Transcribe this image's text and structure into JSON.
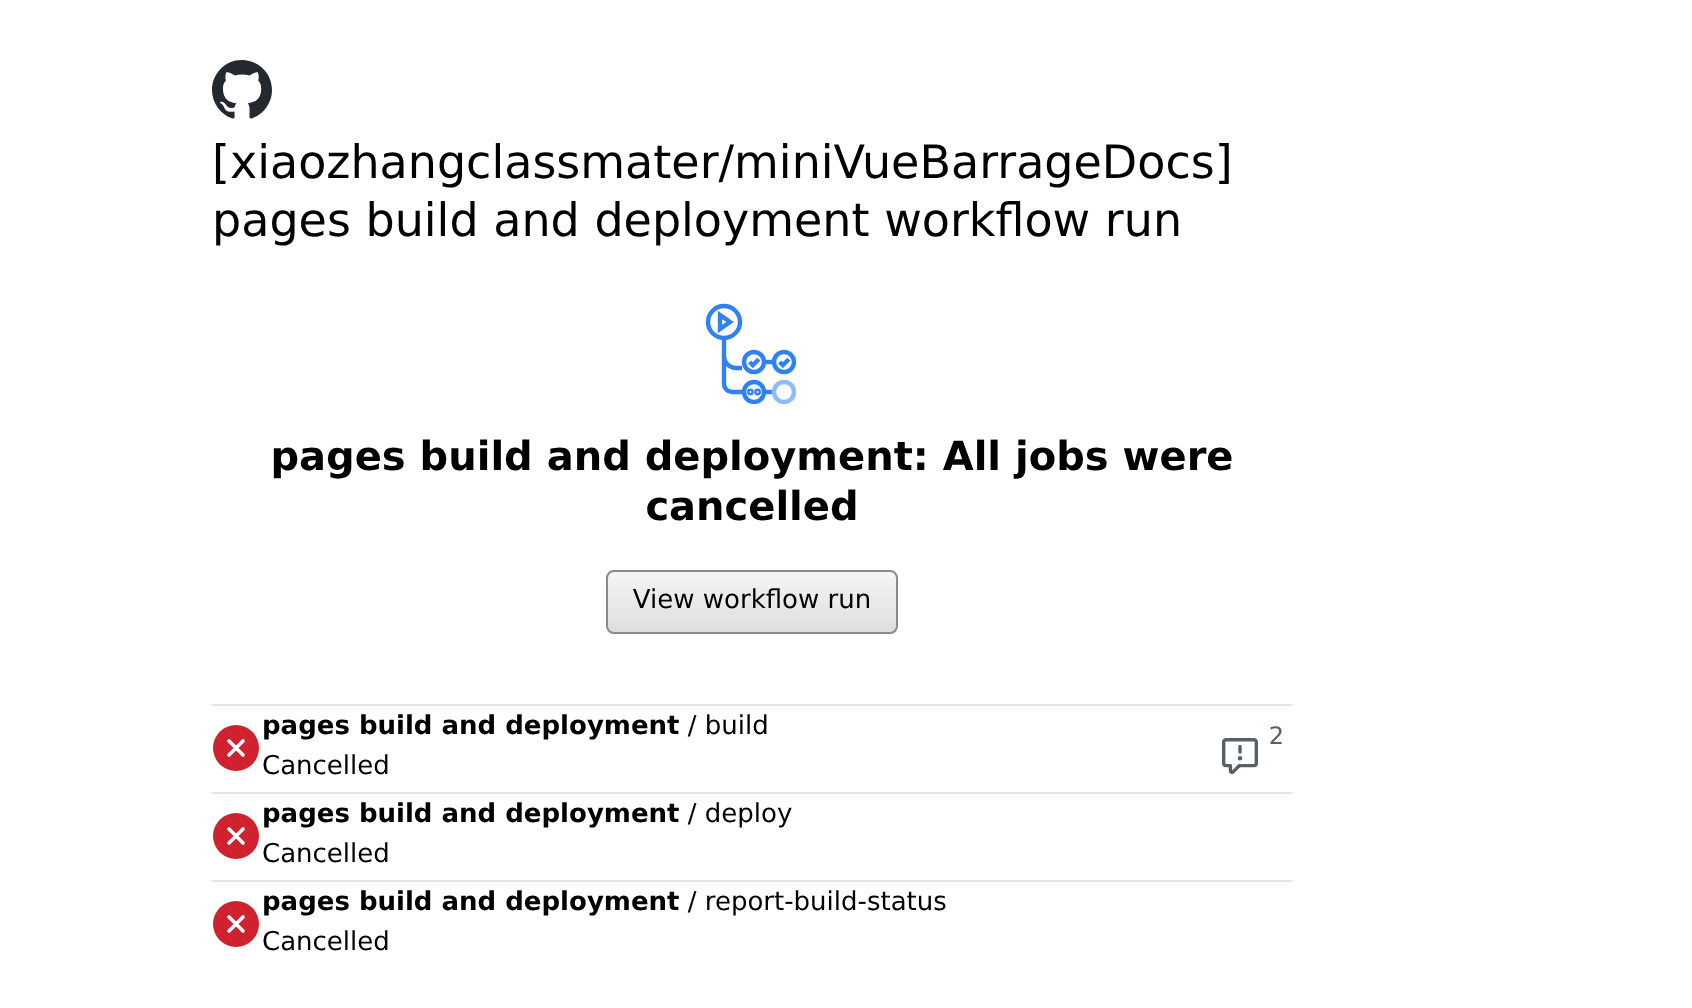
{
  "header": {
    "title": "[xiaozhangclassmater/miniVueBarrageDocs]",
    "subtitle": "pages build and deployment workflow run"
  },
  "summary": {
    "heading": "pages build and deployment: All jobs were cancelled",
    "button": "View workflow run"
  },
  "jobs": [
    {
      "kind": "cancelled",
      "title": "**pages build and deployment** / build",
      "status": "Cancelled",
      "annotations": "2"
    },
    {
      "kind": "cancelled",
      "title": "**pages build and deployment** / deploy",
      "status": "Cancelled"
    },
    {
      "kind": "cancelled",
      "title": "**pages build and deployment** / report-build-status",
      "status": "Cancelled"
    }
  ]
}
